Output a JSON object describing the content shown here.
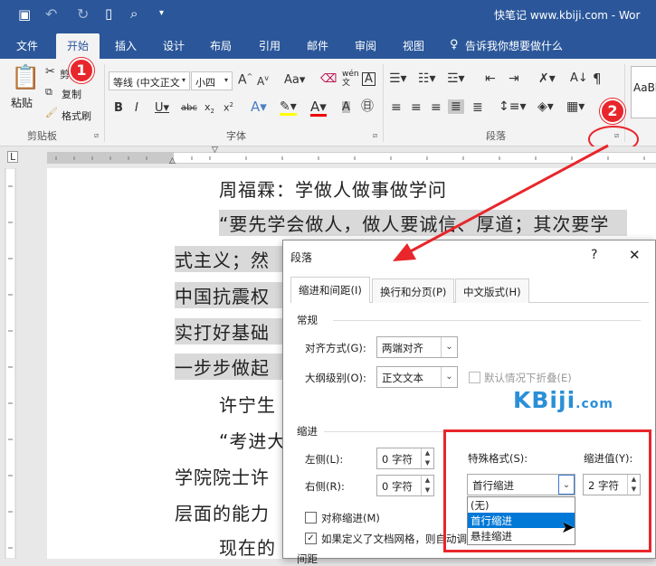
{
  "titlebar": {
    "title": "快笔记  www.kbiji.com - Wor"
  },
  "tabs": [
    "文件",
    "开始",
    "插入",
    "设计",
    "布局",
    "引用",
    "邮件",
    "审阅",
    "视图"
  ],
  "tellme": "告诉我你想要做什么",
  "clipboard": {
    "paste": "粘贴",
    "cut": "剪",
    "copy": "复制",
    "format_painter": "格式刷",
    "group": "剪贴板"
  },
  "font": {
    "name": "等线 (中文正文",
    "size": "小四",
    "group": "字体",
    "wen": "wén"
  },
  "paragraph": {
    "group": "段落"
  },
  "styles_preview": "AaBb",
  "badges": {
    "one": "1",
    "two": "2"
  },
  "doc": {
    "line1": "周福霖：学做人做事做学问",
    "line2": "“要先学会做人，做人要诚信、厚道；其次要学",
    "line3": "式主义；然",
    "line4": "中国抗震权",
    "line5": "实打好基础",
    "line6": "一步步做起",
    "line7": "许宁生",
    "line8": "“考进大",
    "line9": "学院院士许",
    "line10": "层面的能力",
    "line11": "现在的"
  },
  "dialog": {
    "title": "段落",
    "help": "?",
    "close": "✕",
    "tabs": [
      "缩进和间距(I)",
      "换行和分页(P)",
      "中文版式(H)"
    ],
    "general": "常规",
    "align_label": "对齐方式(G):",
    "align_value": "两端对齐",
    "outline_label": "大纲级别(O):",
    "outline_value": "正文文本",
    "collapse_label": "默认情况下折叠(E)",
    "indent": "缩进",
    "left_label": "左侧(L):",
    "left_value": "0 字符",
    "right_label": "右侧(R):",
    "right_value": "0 字符",
    "special_label": "特殊格式(S):",
    "special_value": "首行缩进",
    "indent_by_label": "缩进值(Y):",
    "indent_by_value": "2 字符",
    "mirror_label": "对称缩进(M)",
    "grid_label": "如果定义了文档网格，则自动调",
    "spacing": "间距",
    "options": [
      "(无)",
      "首行缩进",
      "悬挂缩进"
    ],
    "watermark": "KBiji",
    "watermark_domain": ".com"
  }
}
